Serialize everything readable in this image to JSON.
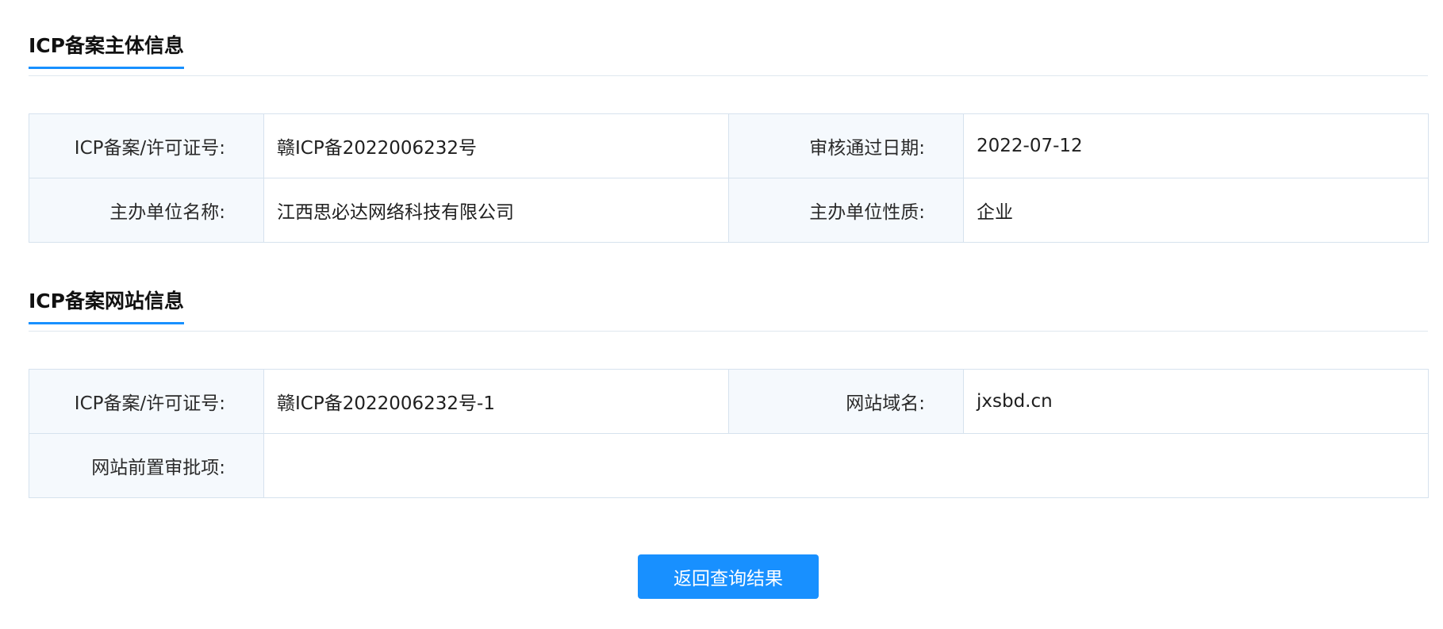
{
  "subject_section": {
    "title": "ICP备案主体信息",
    "rows": [
      [
        {
          "label": "ICP备案/许可证号:",
          "value": "赣ICP备2022006232号"
        },
        {
          "label": "审核通过日期:",
          "value": "2022-07-12"
        }
      ],
      [
        {
          "label": "主办单位名称:",
          "value": "江西思必达网络科技有限公司"
        },
        {
          "label": "主办单位性质:",
          "value": "企业"
        }
      ]
    ]
  },
  "website_section": {
    "title": "ICP备案网站信息",
    "rows": [
      [
        {
          "label": "ICP备案/许可证号:",
          "value": "赣ICP备2022006232号-1"
        },
        {
          "label": "网站域名:",
          "value": "jxsbd.cn"
        }
      ],
      [
        {
          "label": "网站前置审批项:",
          "value": ""
        }
      ]
    ]
  },
  "return_button": {
    "label": "返回查询结果"
  }
}
